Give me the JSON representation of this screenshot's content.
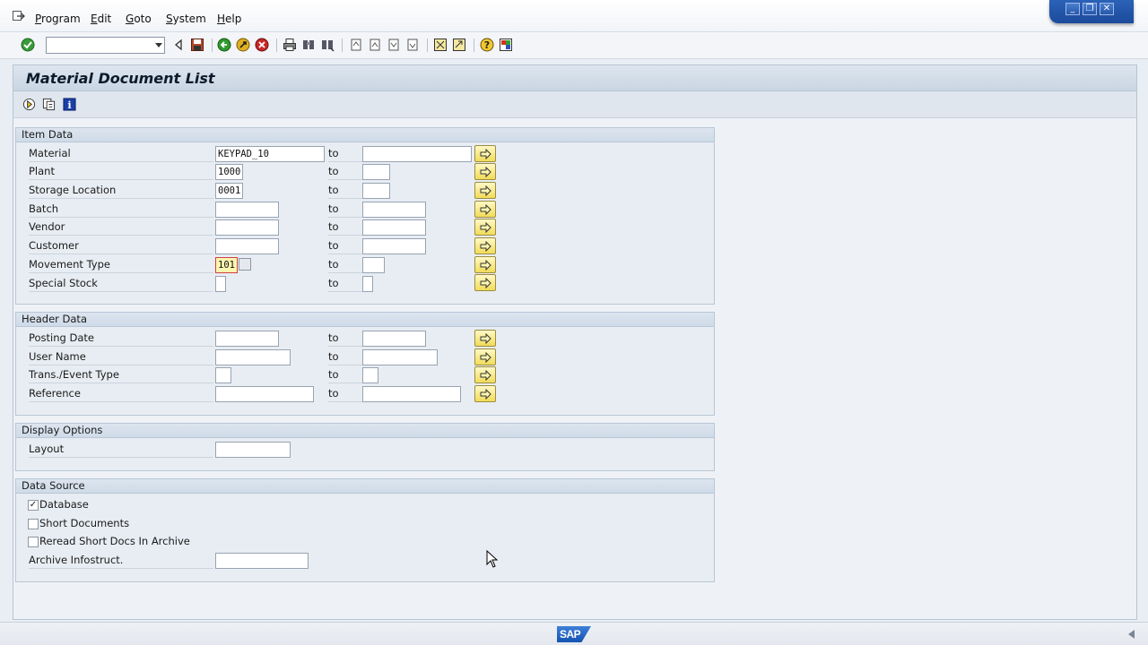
{
  "menu": {
    "items": [
      {
        "label": "Program",
        "accel": "P",
        "rest": "rogram"
      },
      {
        "label": "Edit",
        "accel": "E",
        "rest": "dit"
      },
      {
        "label": "Goto",
        "accel": "G",
        "rest": "oto"
      },
      {
        "label": "System",
        "accel": "S",
        "rest": "ystem"
      },
      {
        "label": "Help",
        "accel": "H",
        "rest": "elp"
      }
    ]
  },
  "window_controls": {
    "minimize": "_",
    "restore": "❐",
    "close": "✕"
  },
  "toolbar": {
    "command_field_value": ""
  },
  "page": {
    "title": "Material Document List"
  },
  "item_data": {
    "title": "Item Data",
    "to_label": "to",
    "rows": [
      {
        "label": "Material",
        "from": "KEYPAD_10",
        "to": ""
      },
      {
        "label": "Plant",
        "from": "1000",
        "to": ""
      },
      {
        "label": "Storage Location",
        "from": "0001",
        "to": ""
      },
      {
        "label": "Batch",
        "from": "",
        "to": ""
      },
      {
        "label": "Vendor",
        "from": "",
        "to": ""
      },
      {
        "label": "Customer",
        "from": "",
        "to": ""
      },
      {
        "label": "Movement Type",
        "from": "101",
        "to": ""
      },
      {
        "label": "Special Stock",
        "from": "",
        "to": ""
      }
    ]
  },
  "header_data": {
    "title": "Header Data",
    "to_label": "to",
    "rows": [
      {
        "label": "Posting Date",
        "from": "",
        "to": ""
      },
      {
        "label": "User Name",
        "from": "",
        "to": ""
      },
      {
        "label": "Trans./Event Type",
        "from": "",
        "to": ""
      },
      {
        "label": "Reference",
        "from": "",
        "to": ""
      }
    ]
  },
  "display_options": {
    "title": "Display Options",
    "layout_label": "Layout",
    "layout_value": ""
  },
  "data_source": {
    "title": "Data Source",
    "checkboxes": [
      {
        "label": "Database",
        "checked": true
      },
      {
        "label": "Short Documents",
        "checked": false
      },
      {
        "label": "Reread Short Docs In Archive",
        "checked": false
      }
    ],
    "archive_label": "Archive Infostruct.",
    "archive_value": ""
  },
  "status": {
    "logo_text": "SAP"
  },
  "colors": {
    "accent_blue": "#1b4a9a",
    "multi_select_yellow": "#f1dc58",
    "active_field": "#fbf6b0"
  }
}
